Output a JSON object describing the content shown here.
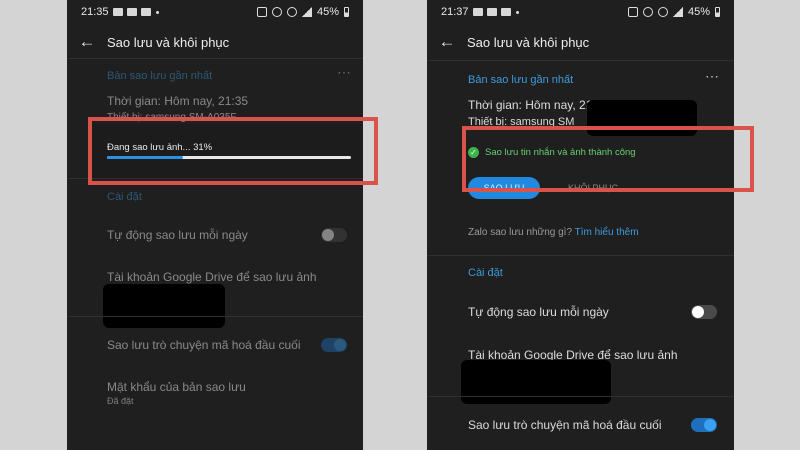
{
  "left": {
    "status": {
      "time": "21:35",
      "battery": "45%"
    },
    "title": "Sao lưu và khôi phục",
    "recent_backup_label": "Bản sao lưu gần nhất",
    "time_line": "Thời gian: Hôm nay, 21:35",
    "device_line": "Thiết bị: samsung SM-A035F",
    "progress_text": "Đang sao lưu ảnh... 31%",
    "progress_value": 0.31,
    "settings_label": "Cài đặt",
    "auto_backup": "Tự động sao lưu mỗi ngày",
    "drive_account": "Tài khoản Google Drive để sao lưu ảnh",
    "e2ee_backup": "Sao lưu trò chuyện mã hoá đầu cuối",
    "backup_password": "Mật khẩu của bản sao lưu",
    "backup_password_sub": "Đã đặt"
  },
  "right": {
    "status": {
      "time": "21:37",
      "battery": "45%"
    },
    "title": "Sao lưu và khôi phục",
    "recent_backup_label": "Bản sao lưu gần nhất",
    "time_line": "Thời gian: Hôm nay, 21:35",
    "device_line": "Thiết bị: samsung SM",
    "success_text": "Sao lưu tin nhắn và ảnh thành công",
    "backup_button": "SAO LƯU",
    "restore_button": "KHÔI PHỤC",
    "info_question": "Zalo sao lưu những gì?",
    "info_link": "Tìm hiểu thêm",
    "settings_label": "Cài đặt",
    "auto_backup": "Tự động sao lưu mỗi ngày",
    "drive_account": "Tài khoản Google Drive để sao lưu ảnh",
    "e2ee_backup": "Sao lưu trò chuyện mã hoá đầu cuối"
  },
  "colors": {
    "highlight": "#d9534a",
    "accent": "#3d9bdc",
    "success": "#3cb44b"
  }
}
